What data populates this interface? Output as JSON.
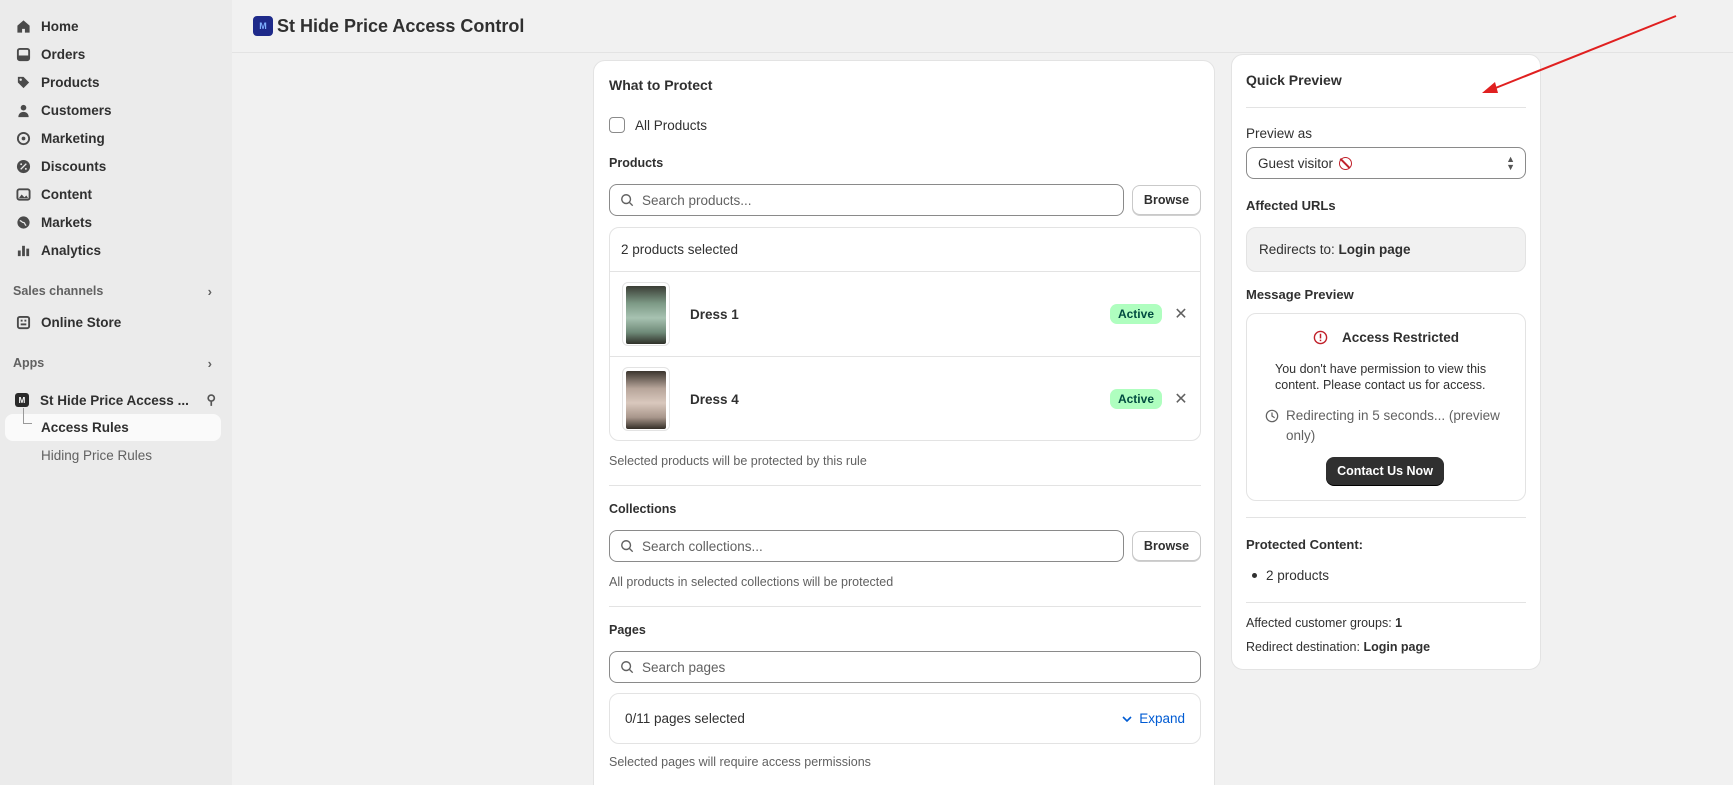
{
  "sidebar": {
    "items": [
      {
        "label": "Home",
        "icon": "home-icon"
      },
      {
        "label": "Orders",
        "icon": "orders-icon"
      },
      {
        "label": "Products",
        "icon": "tag-icon"
      },
      {
        "label": "Customers",
        "icon": "person-icon"
      },
      {
        "label": "Marketing",
        "icon": "target-icon"
      },
      {
        "label": "Discounts",
        "icon": "discount-icon"
      },
      {
        "label": "Content",
        "icon": "image-icon"
      },
      {
        "label": "Markets",
        "icon": "globe-icon"
      },
      {
        "label": "Analytics",
        "icon": "bar-chart-icon"
      }
    ],
    "sales_channels_label": "Sales channels",
    "online_store_label": "Online Store",
    "apps_label": "Apps",
    "app_name": "St Hide Price Access ...",
    "access_rules_label": "Access Rules",
    "hiding_price_rules_label": "Hiding Price Rules"
  },
  "header": {
    "title": "St Hide Price Access Control"
  },
  "protect": {
    "title": "What to Protect",
    "all_products_label": "All Products",
    "products_label": "Products",
    "products_search_placeholder": "Search products...",
    "browse_label": "Browse",
    "selected_count": "2 products selected",
    "products": [
      {
        "name": "Dress 1",
        "status": "Active"
      },
      {
        "name": "Dress 4",
        "status": "Active"
      }
    ],
    "products_help": "Selected products will be protected by this rule",
    "collections_label": "Collections",
    "collections_search_placeholder": "Search collections...",
    "collections_help": "All products in selected collections will be protected",
    "pages_label": "Pages",
    "pages_search_placeholder": "Search pages",
    "pages_selected": "0/11 pages selected",
    "expand_label": "Expand",
    "pages_help": "Selected pages will require access permissions"
  },
  "preview": {
    "title": "Quick Preview",
    "preview_as_label": "Preview as",
    "preview_as_value": "Guest visitor",
    "affected_urls_label": "Affected URLs",
    "redirects_prefix": "Redirects to:",
    "redirects_value": "Login page",
    "message_preview_label": "Message Preview",
    "access_restricted": "Access Restricted",
    "message_text": "You don't have permission to view this content. Please contact us for access.",
    "redirecting_text": "Redirecting in 5 seconds... (preview only)",
    "contact_button": "Contact Us Now",
    "protected_content_label": "Protected Content:",
    "protected_items": [
      "2 products"
    ],
    "affected_groups_prefix": "Affected customer groups:",
    "affected_groups_value": "1",
    "redirect_dest_prefix": "Redirect destination:",
    "redirect_dest_value": "Login page"
  },
  "colors": {
    "accent_link": "#005bd3",
    "badge_bg": "#affebf",
    "badge_text": "#014b40",
    "annotation_arrow": "#e02020"
  }
}
